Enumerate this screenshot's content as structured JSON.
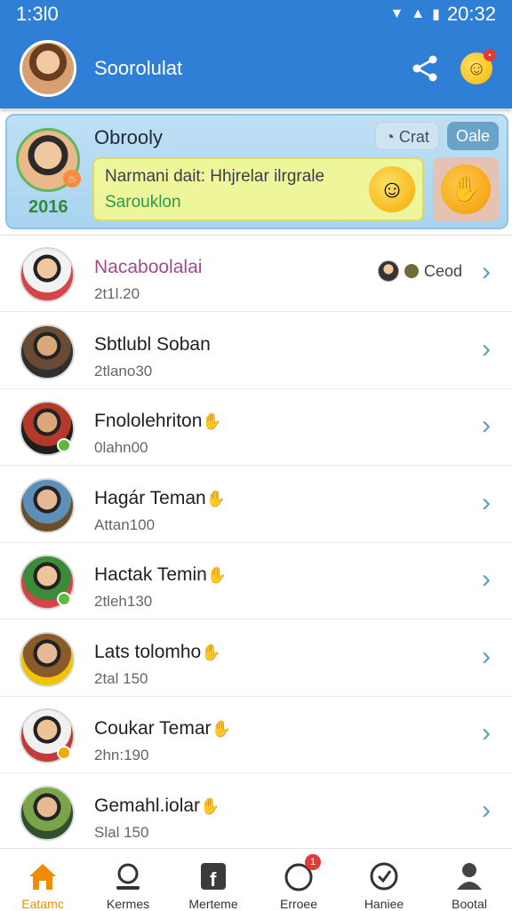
{
  "status_bar": {
    "time_left": "1:3l0",
    "time_right": "20:32"
  },
  "app_bar": {
    "title": "Soorolulat"
  },
  "featured": {
    "name": "Obrooly",
    "year": "2016",
    "pill_1": "Crat",
    "pill_2": "Oale",
    "message_line1": "Narmani dait: Hhjrelar ilrgrale",
    "message_line2": "Sarouklon"
  },
  "contacts": [
    {
      "name": "Nacaboolalai",
      "sub": "2t1l.20",
      "meta": "Ceod",
      "name_color": "pink",
      "avatar": [
        "#f2f2f2",
        "#d64545",
        "#f0c8a0"
      ],
      "status": ""
    },
    {
      "name": "Sbtlubl Soban",
      "sub": "2tlano30",
      "meta": "",
      "name_color": "",
      "avatar": [
        "#6a4a33",
        "#2f2f2f",
        "#d9a77a"
      ],
      "status": ""
    },
    {
      "name": "Fnololehriton",
      "sub": "0lahn00",
      "meta": "",
      "name_color": "",
      "avatar": [
        "#b33a28",
        "#1f1f1f",
        "#d9a77a"
      ],
      "status": "#5cba3c"
    },
    {
      "name": "Hagár Teman",
      "sub": "Attan100",
      "meta": "",
      "name_color": "",
      "avatar": [
        "#5d90b8",
        "#6b4f2a",
        "#e7b993"
      ],
      "status": ""
    },
    {
      "name": "Hactak Temin",
      "sub": "2tleh130",
      "meta": "",
      "name_color": "",
      "avatar": [
        "#3c8a3c",
        "#d64545",
        "#eec39a"
      ],
      "status": "#5cba3c"
    },
    {
      "name": "Lats tolomho",
      "sub": "2tal 150",
      "meta": "",
      "name_color": "",
      "avatar": [
        "#8a5a2a",
        "#f0c400",
        "#e7b993"
      ],
      "status": ""
    },
    {
      "name": "Coukar Temar",
      "sub": "2hn:190",
      "meta": "",
      "name_color": "",
      "avatar": [
        "#f0f0f0",
        "#c23b3b",
        "#eec39a"
      ],
      "status": "#f5a800"
    },
    {
      "name": "Gemahl.iolar",
      "sub": "Slal 150",
      "meta": "",
      "name_color": "",
      "avatar": [
        "#7aa34a",
        "#2f4f2f",
        "#e7b993"
      ],
      "status": ""
    }
  ],
  "nav": {
    "items": [
      {
        "label": "Eatamc",
        "icon": "home-icon",
        "active": true
      },
      {
        "label": "Kermes",
        "icon": "circle-icon",
        "active": false
      },
      {
        "label": "Merteme",
        "icon": "facebook-icon",
        "active": false
      },
      {
        "label": "Erroee",
        "icon": "notification-icon",
        "active": false,
        "badge": "1"
      },
      {
        "label": "Haniee",
        "icon": "compass-icon",
        "active": false
      },
      {
        "label": "Bootal",
        "icon": "profile-icon",
        "active": false
      }
    ]
  },
  "colors": {
    "primary": "#2f7fd6",
    "accent": "#f28b00",
    "chevron": "#5aa0b8"
  }
}
